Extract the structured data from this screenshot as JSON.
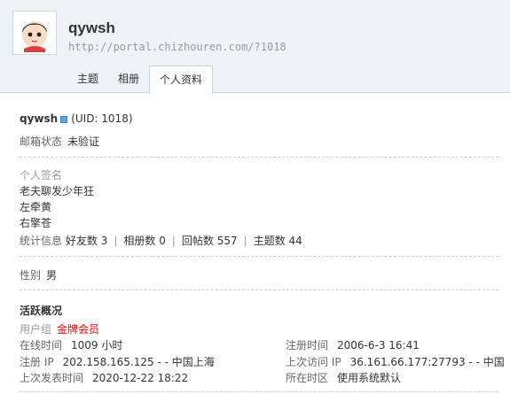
{
  "profile": {
    "username": "qywsh",
    "url": "http://portal.chizhouren.com/?1018"
  },
  "tabs": [
    {
      "label": "主题"
    },
    {
      "label": "相册"
    },
    {
      "label": "个人资料"
    }
  ],
  "info": {
    "uid_text": "(UID: 1018)",
    "email_label": "邮箱状态",
    "email_value": "未验证",
    "signature_label": "个人签名",
    "signature_lines": [
      "老夫聊发少年狂",
      "左牵黄",
      "右擎苍"
    ],
    "stats_label": "统计信息",
    "stats": [
      {
        "label": "好友数",
        "value": "3"
      },
      {
        "label": "相册数",
        "value": "0"
      },
      {
        "label": "回帖数",
        "value": "557"
      },
      {
        "label": "主题数",
        "value": "44"
      }
    ],
    "gender_label": "性别",
    "gender_value": "男"
  },
  "activity": {
    "title": "活跃概况",
    "group_label": "用户组",
    "group_value": "金牌会员",
    "online_label": "在线时间",
    "online_value": "1009 小时",
    "reg_time_label": "注册时间",
    "reg_time_value": "2006-6-3 16:41",
    "reg_ip_label": "注册 IP",
    "reg_ip_value": "202.158.165.125 - - 中国上海",
    "last_ip_label": "上次访问 IP",
    "last_ip_value": "36.161.66.177:27793 - - 中国",
    "last_post_label": "上次发表时间",
    "last_post_value": "2020-12-22 18:22",
    "timezone_label": "所在时区",
    "timezone_value": "使用系统默认"
  },
  "colors": {
    "header_bg": "#eef2f7",
    "border": "#c2d5e3",
    "gold_member": "#ff0000"
  }
}
